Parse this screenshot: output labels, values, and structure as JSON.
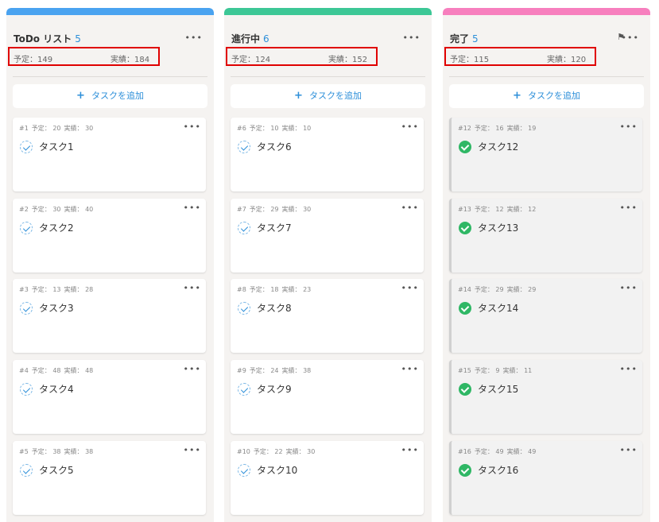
{
  "columns": [
    {
      "title": "ToDo リスト",
      "count": "5",
      "color": "#4aa3f0",
      "plan_label": "予定：149",
      "actual_label": "実績：184",
      "add_label": "タスクを追加",
      "add_icon": "+",
      "more_icon": "•••",
      "cards": [
        {
          "id": "#1",
          "plan": "予定： 20",
          "actual": "実績： 30",
          "name": "タスク1"
        },
        {
          "id": "#2",
          "plan": "予定： 30",
          "actual": "実績： 40",
          "name": "タスク2"
        },
        {
          "id": "#3",
          "plan": "予定： 13",
          "actual": "実績： 28",
          "name": "タスク3"
        },
        {
          "id": "#4",
          "plan": "予定： 48",
          "actual": "実績： 48",
          "name": "タスク4"
        },
        {
          "id": "#5",
          "plan": "予定： 38",
          "actual": "実績： 38",
          "name": "タスク5"
        }
      ]
    },
    {
      "title": "進行中",
      "count": "6",
      "color": "#3cc796",
      "plan_label": "予定：124",
      "actual_label": "実績：152",
      "add_label": "タスクを追加",
      "add_icon": "+",
      "more_icon": "•••",
      "cards": [
        {
          "id": "#6",
          "plan": "予定： 10",
          "actual": "実績： 10",
          "name": "タスク6"
        },
        {
          "id": "#7",
          "plan": "予定： 29",
          "actual": "実績： 30",
          "name": "タスク7"
        },
        {
          "id": "#8",
          "plan": "予定： 18",
          "actual": "実績： 23",
          "name": "タスク8"
        },
        {
          "id": "#9",
          "plan": "予定： 24",
          "actual": "実績： 38",
          "name": "タスク9"
        },
        {
          "id": "#10",
          "plan": "予定： 22",
          "actual": "実績： 30",
          "name": "タスク10"
        }
      ]
    },
    {
      "title": "完了",
      "count": "5",
      "color": "#f77fbe",
      "plan_label": "予定：115",
      "actual_label": "実績：120",
      "add_label": "タスクを追加",
      "add_icon": "+",
      "more_icon": "•••",
      "flag_icon": "⚑",
      "cards": [
        {
          "id": "#12",
          "plan": "予定： 16",
          "actual": "実績： 19",
          "name": "タスク12"
        },
        {
          "id": "#13",
          "plan": "予定： 12",
          "actual": "実績： 12",
          "name": "タスク13"
        },
        {
          "id": "#14",
          "plan": "予定： 29",
          "actual": "実績： 29",
          "name": "タスク14"
        },
        {
          "id": "#15",
          "plan": "予定： 9",
          "actual": "実績： 11",
          "name": "タスク15"
        },
        {
          "id": "#16",
          "plan": "予定： 49",
          "actual": "実績： 49",
          "name": "タスク16"
        }
      ]
    }
  ]
}
